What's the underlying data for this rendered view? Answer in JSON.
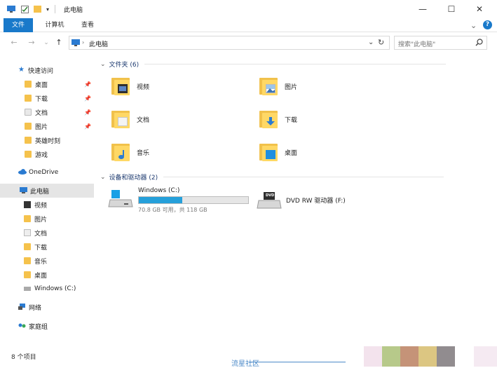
{
  "window": {
    "title": "此电脑",
    "qa_dropdown": "▾",
    "controls": {
      "minimize": "—",
      "maximize": "☐",
      "close": "✕"
    }
  },
  "ribbon": {
    "tabs": [
      {
        "label": "文件",
        "active": true
      },
      {
        "label": "计算机"
      },
      {
        "label": "查看"
      }
    ],
    "collapse": "⌄",
    "help": "?"
  },
  "address": {
    "back": "←",
    "forward": "→",
    "recent": "⌄",
    "up": "↑",
    "path": "此电脑",
    "dropdown": "⌄",
    "refresh": "↻",
    "search_placeholder": "搜索\"此电脑\"",
    "search_icon": "search-icon"
  },
  "sidebar": {
    "quick_access": "快速访问",
    "quick_items": [
      {
        "label": "桌面",
        "pinned": true
      },
      {
        "label": "下载",
        "pinned": true
      },
      {
        "label": "文档",
        "pinned": true
      },
      {
        "label": "图片",
        "pinned": true
      },
      {
        "label": "英雄时刻",
        "pinned": false
      },
      {
        "label": "游戏",
        "pinned": false
      }
    ],
    "pin_glyph": "📌",
    "onedrive": "OneDrive",
    "this_pc": "此电脑",
    "pc_items": [
      "视频",
      "图片",
      "文档",
      "下载",
      "音乐",
      "桌面",
      "Windows (C:)"
    ],
    "network": "网络",
    "homegroup": "家庭组"
  },
  "content": {
    "folders_header": "文件夹 (6)",
    "folders": [
      {
        "label": "视频",
        "icon": "video-folder-icon"
      },
      {
        "label": "图片",
        "icon": "pictures-folder-icon"
      },
      {
        "label": "文档",
        "icon": "documents-folder-icon"
      },
      {
        "label": "下载",
        "icon": "downloads-folder-icon"
      },
      {
        "label": "音乐",
        "icon": "music-folder-icon"
      },
      {
        "label": "桌面",
        "icon": "desktop-folder-icon"
      }
    ],
    "devices_header": "设备和驱动器 (2)",
    "drives": [
      {
        "label": "Windows (C:)",
        "space": "70.8 GB 可用，共 118 GB",
        "used_fraction": 0.4
      },
      {
        "label": "DVD RW 驱动器 (F:)",
        "disc_text": "DVD"
      }
    ],
    "collapse_glyph": "⌄"
  },
  "status": {
    "count": "8 个项目"
  },
  "watermark": "流星社区",
  "colors": {
    "accent": "#1979ca",
    "folder": "#f5c24c",
    "drive_bar": "#26a0da",
    "swatches": [
      "#f3e3ed",
      "#b7c98a",
      "#c59378",
      "#dcc682",
      "#918c8f",
      "#f5eaf2"
    ]
  }
}
